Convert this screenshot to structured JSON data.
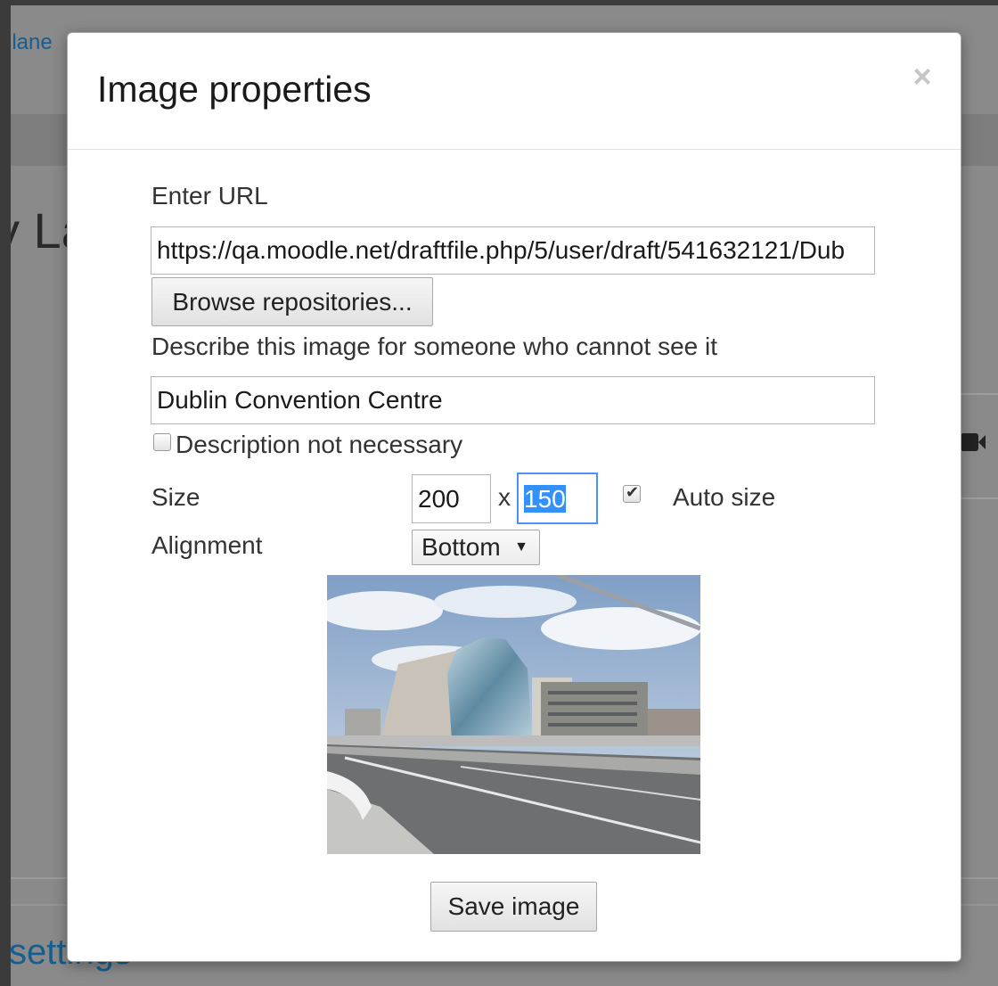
{
  "background": {
    "top_link_fragment": "llane",
    "title_fragment": "y La",
    "bottom_link_fragment": "settings"
  },
  "dialog": {
    "title": "Image properties",
    "close_label": "×",
    "url_label": "Enter URL",
    "url_value": "https://qa.moodle.net/draftfile.php/5/user/draft/541632121/Dub",
    "browse_label": "Browse repositories...",
    "description_label": "Describe this image for someone who cannot see it",
    "description_value": "Dublin Convention Centre",
    "description_not_necessary_label": "Description not necessary",
    "description_not_necessary_checked": false,
    "size_label": "Size",
    "width_value": "200",
    "size_separator": "x",
    "height_value": "150",
    "auto_size_label": "Auto size",
    "auto_size_checked": true,
    "alignment_label": "Alignment",
    "alignment_value": "Bottom",
    "save_label": "Save image"
  },
  "colors": {
    "selection": "#3390ff",
    "link": "#155e8e",
    "overlay": "#8a8a8a"
  }
}
